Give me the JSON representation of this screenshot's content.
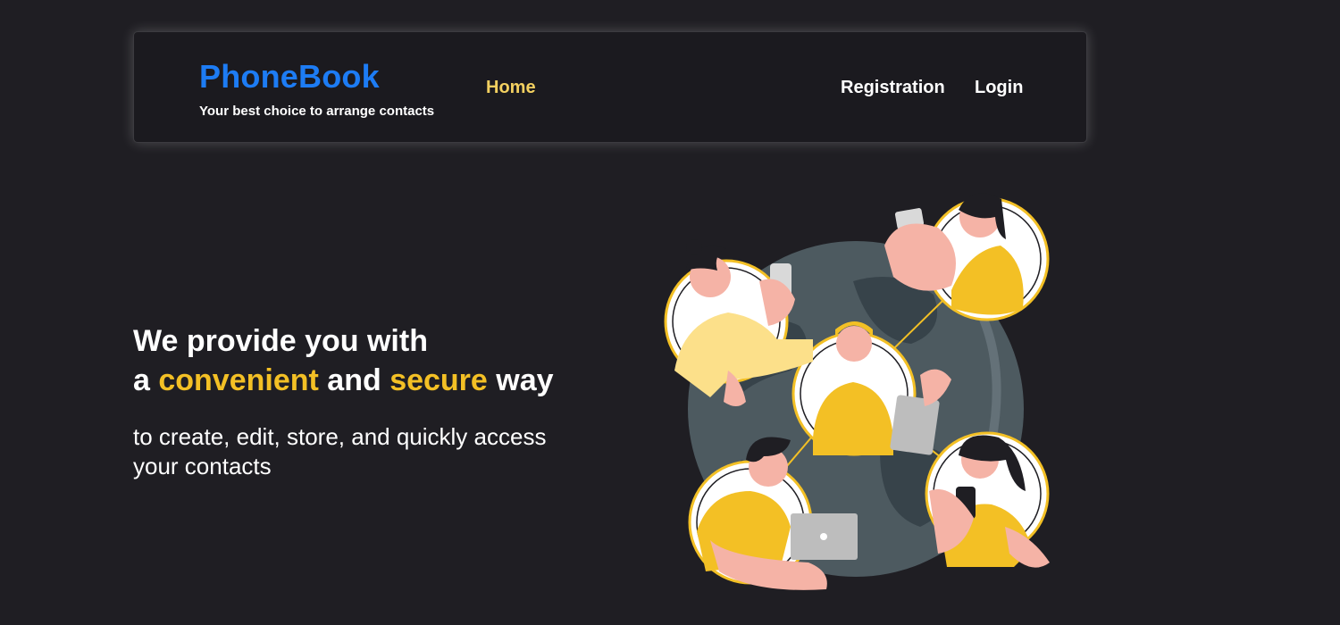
{
  "header": {
    "logo": "PhoneBook",
    "tagline": "Your best choice to arrange contacts",
    "nav": {
      "home": "Home",
      "registration": "Registration",
      "login": "Login"
    }
  },
  "hero": {
    "line1": "We provide you with",
    "line2_a": "a ",
    "line2_accent1": "convenient",
    "line2_b": " and ",
    "line2_accent2": "secure",
    "line2_c": " way",
    "subtitle": "to create, edit, store, and quickly access your contacts"
  },
  "colors": {
    "background": "#1f1e23",
    "brand": "#1d7cf4",
    "accent": "#f3c025",
    "nav_active": "#f3d060"
  },
  "illustration": {
    "icon": "people-network-globe-illustration"
  }
}
